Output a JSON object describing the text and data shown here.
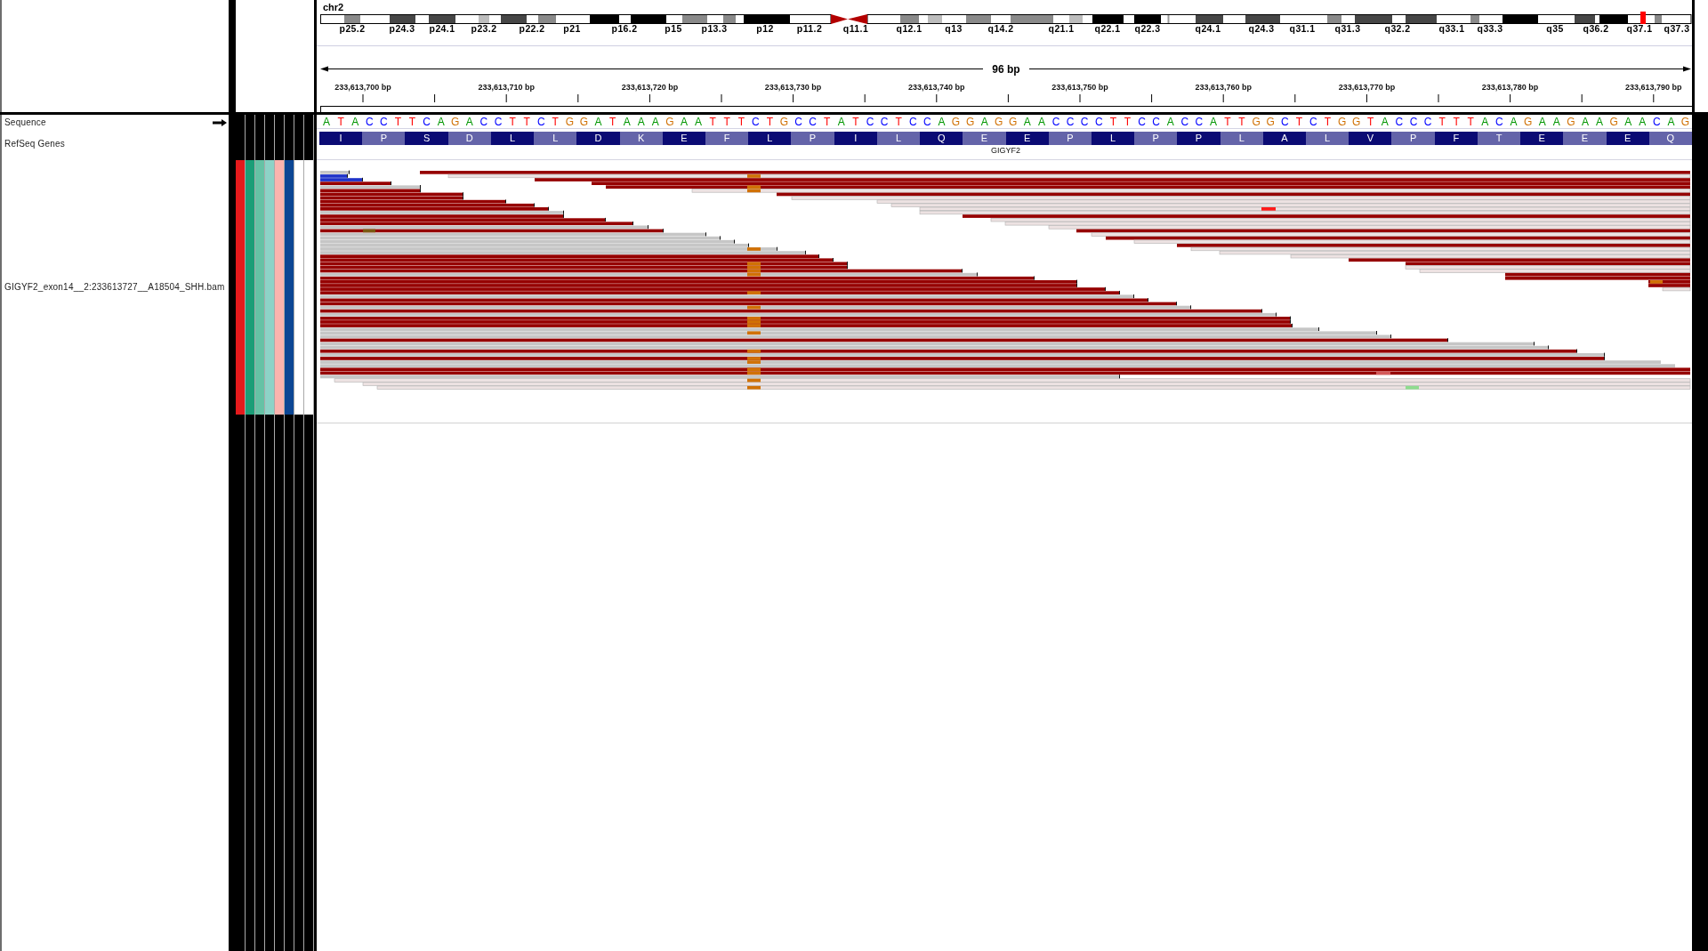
{
  "ideogram": {
    "chromosome": "chr2",
    "bands": [
      "p25.2",
      "p24.3",
      "p24.1",
      "p23.2",
      "p22.2",
      "p21",
      "p16.2",
      "p15",
      "p13.3",
      "p12",
      "p11.2",
      "q11.1",
      "q12.1",
      "q13",
      "q14.2",
      "q21.1",
      "q22.1",
      "q22.3",
      "q24.1",
      "q24.3",
      "q31.1",
      "q31.3",
      "q32.2",
      "q33.1",
      "q33.3",
      "q35",
      "q36.2",
      "q37.1",
      "q37.3"
    ]
  },
  "ruler": {
    "span": "96 bp",
    "ticks": [
      "233,613,700 bp",
      "233,613,710 bp",
      "233,613,720 bp",
      "233,613,730 bp",
      "233,613,740 bp",
      "233,613,750 bp",
      "233,613,760 bp",
      "233,613,770 bp",
      "233,613,780 bp",
      "233,613,790 bp"
    ]
  },
  "tracks": [
    {
      "kind": "sequence",
      "name": "Sequence",
      "bases": [
        {
          "base": "A",
          "color": "#009600"
        },
        {
          "base": "T",
          "color": "#ff0000"
        },
        {
          "base": "A",
          "color": "#009600"
        },
        {
          "base": "C",
          "color": "#0000ff"
        },
        {
          "base": "C",
          "color": "#0000ff"
        },
        {
          "base": "T",
          "color": "#ff0000"
        },
        {
          "base": "T",
          "color": "#ff0000"
        },
        {
          "base": "C",
          "color": "#0000ff"
        },
        {
          "base": "A",
          "color": "#009600"
        },
        {
          "base": "G",
          "color": "#d17105"
        },
        {
          "base": "A",
          "color": "#009600"
        },
        {
          "base": "C",
          "color": "#0000ff"
        },
        {
          "base": "C",
          "color": "#0000ff"
        },
        {
          "base": "T",
          "color": "#ff0000"
        },
        {
          "base": "T",
          "color": "#ff0000"
        },
        {
          "base": "C",
          "color": "#0000ff"
        },
        {
          "base": "T",
          "color": "#ff0000"
        },
        {
          "base": "G",
          "color": "#d17105"
        },
        {
          "base": "G",
          "color": "#d17105"
        },
        {
          "base": "A",
          "color": "#009600"
        },
        {
          "base": "T",
          "color": "#ff0000"
        },
        {
          "base": "A",
          "color": "#009600"
        },
        {
          "base": "A",
          "color": "#009600"
        },
        {
          "base": "A",
          "color": "#009600"
        },
        {
          "base": "G",
          "color": "#d17105"
        },
        {
          "base": "A",
          "color": "#009600"
        },
        {
          "base": "A",
          "color": "#009600"
        },
        {
          "base": "T",
          "color": "#ff0000"
        },
        {
          "base": "T",
          "color": "#ff0000"
        },
        {
          "base": "T",
          "color": "#ff0000"
        },
        {
          "base": "C",
          "color": "#0000ff"
        },
        {
          "base": "T",
          "color": "#ff0000"
        },
        {
          "base": "G",
          "color": "#d17105"
        },
        {
          "base": "C",
          "color": "#0000ff"
        },
        {
          "base": "C",
          "color": "#0000ff"
        },
        {
          "base": "T",
          "color": "#ff0000"
        },
        {
          "base": "A",
          "color": "#009600"
        },
        {
          "base": "T",
          "color": "#ff0000"
        },
        {
          "base": "C",
          "color": "#0000ff"
        },
        {
          "base": "C",
          "color": "#0000ff"
        },
        {
          "base": "T",
          "color": "#ff0000"
        },
        {
          "base": "C",
          "color": "#0000ff"
        },
        {
          "base": "C",
          "color": "#0000ff"
        },
        {
          "base": "A",
          "color": "#009600"
        },
        {
          "base": "G",
          "color": "#d17105"
        },
        {
          "base": "G",
          "color": "#d17105"
        },
        {
          "base": "A",
          "color": "#009600"
        },
        {
          "base": "G",
          "color": "#d17105"
        },
        {
          "base": "G",
          "color": "#d17105"
        },
        {
          "base": "A",
          "color": "#009600"
        },
        {
          "base": "A",
          "color": "#009600"
        },
        {
          "base": "C",
          "color": "#0000ff"
        },
        {
          "base": "C",
          "color": "#0000ff"
        },
        {
          "base": "C",
          "color": "#0000ff"
        },
        {
          "base": "C",
          "color": "#0000ff"
        },
        {
          "base": "T",
          "color": "#ff0000"
        },
        {
          "base": "T",
          "color": "#ff0000"
        },
        {
          "base": "C",
          "color": "#0000ff"
        },
        {
          "base": "C",
          "color": "#0000ff"
        },
        {
          "base": "A",
          "color": "#009600"
        },
        {
          "base": "C",
          "color": "#0000ff"
        },
        {
          "base": "C",
          "color": "#0000ff"
        },
        {
          "base": "A",
          "color": "#009600"
        },
        {
          "base": "T",
          "color": "#ff0000"
        },
        {
          "base": "T",
          "color": "#ff0000"
        },
        {
          "base": "G",
          "color": "#d17105"
        },
        {
          "base": "G",
          "color": "#d17105"
        },
        {
          "base": "C",
          "color": "#0000ff"
        },
        {
          "base": "T",
          "color": "#ff0000"
        },
        {
          "base": "C",
          "color": "#0000ff"
        },
        {
          "base": "T",
          "color": "#ff0000"
        },
        {
          "base": "G",
          "color": "#d17105"
        },
        {
          "base": "G",
          "color": "#d17105"
        },
        {
          "base": "T",
          "color": "#ff0000"
        },
        {
          "base": "A",
          "color": "#009600"
        },
        {
          "base": "C",
          "color": "#0000ff"
        },
        {
          "base": "C",
          "color": "#0000ff"
        },
        {
          "base": "C",
          "color": "#0000ff"
        },
        {
          "base": "T",
          "color": "#ff0000"
        },
        {
          "base": "T",
          "color": "#ff0000"
        },
        {
          "base": "T",
          "color": "#ff0000"
        },
        {
          "base": "A",
          "color": "#009600"
        },
        {
          "base": "C",
          "color": "#0000ff"
        },
        {
          "base": "A",
          "color": "#009600"
        },
        {
          "base": "G",
          "color": "#d17105"
        },
        {
          "base": "A",
          "color": "#009600"
        },
        {
          "base": "A",
          "color": "#009600"
        },
        {
          "base": "G",
          "color": "#d17105"
        },
        {
          "base": "A",
          "color": "#009600"
        },
        {
          "base": "A",
          "color": "#009600"
        },
        {
          "base": "G",
          "color": "#d17105"
        },
        {
          "base": "A",
          "color": "#009600"
        },
        {
          "base": "A",
          "color": "#009600"
        },
        {
          "base": "C",
          "color": "#0000ff"
        },
        {
          "base": "A",
          "color": "#009600"
        },
        {
          "base": "G",
          "color": "#d17105"
        }
      ]
    },
    {
      "kind": "gene",
      "name": "RefSeq Genes",
      "gene": "GIGYF2",
      "amino_acids": [
        "I",
        "P",
        "S",
        "D",
        "L",
        "L",
        "D",
        "K",
        "E",
        "F",
        "L",
        "P",
        "I",
        "L",
        "Q",
        "E",
        "E",
        "P",
        "L",
        "P",
        "P",
        "L",
        "A",
        "L",
        "V",
        "P",
        "F",
        "T",
        "E",
        "E",
        "E",
        "Q"
      ]
    },
    {
      "kind": "alignment",
      "name": "GIGYF2_exon14__2:233613727__A18504_SHH.bam",
      "attributes": [
        {
          "color": "#e41a1c"
        },
        {
          "color": "#1b9e77"
        },
        {
          "color": "#66c2a5"
        },
        {
          "color": "#8dd3c7"
        },
        {
          "color": "#fbb4ae"
        },
        {
          "color": "#0c4694"
        },
        {
          "color": "#ffffff"
        },
        {
          "color": "#ffffff"
        }
      ]
    }
  ]
}
